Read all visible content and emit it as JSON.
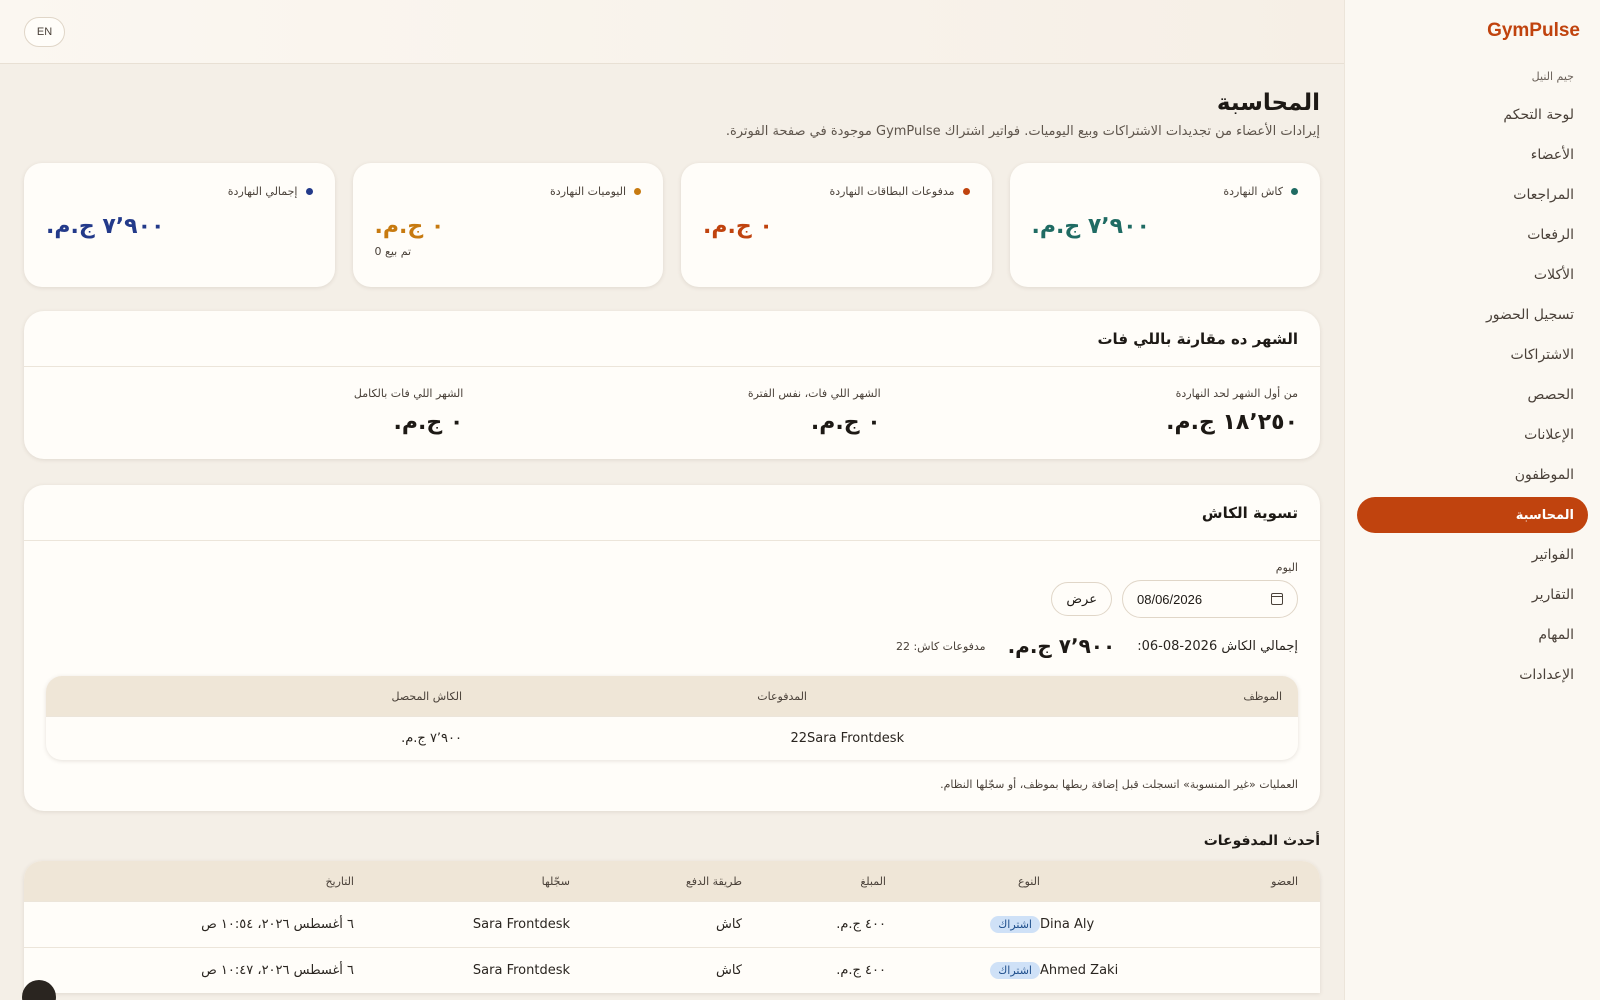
{
  "topbar": {
    "lang_label": "EN"
  },
  "sidebar": {
    "brand": "GymPulse",
    "gym_name": "جيم النيل",
    "items": [
      {
        "label": "لوحة التحكم",
        "key": "dashboard"
      },
      {
        "label": "الأعضاء",
        "key": "members"
      },
      {
        "label": "المراجعات",
        "key": "reviews"
      },
      {
        "label": "الرفعات",
        "key": "lifts"
      },
      {
        "label": "الأكلات",
        "key": "meals"
      },
      {
        "label": "تسجيل الحضور",
        "key": "attendance"
      },
      {
        "label": "الاشتراكات",
        "key": "subscriptions"
      },
      {
        "label": "الحصص",
        "key": "classes"
      },
      {
        "label": "الإعلانات",
        "key": "announcements"
      },
      {
        "label": "الموظفون",
        "key": "staff"
      },
      {
        "label": "المحاسبة",
        "key": "accounting",
        "active": true
      },
      {
        "label": "الفواتير",
        "key": "invoices"
      },
      {
        "label": "التقارير",
        "key": "reports"
      },
      {
        "label": "المهام",
        "key": "tasks"
      },
      {
        "label": "الإعدادات",
        "key": "settings"
      }
    ]
  },
  "header": {
    "title": "المحاسبة",
    "subtitle": "إيرادات الأعضاء من تجديدات الاشتراكات وبيع اليوميات. فواتير اشتراك GymPulse موجودة في صفحة الفوترة."
  },
  "kpis": [
    {
      "label": "كاش النهاردة",
      "value": "٧٬٩٠٠ ج.م.",
      "color": "#1f6b63",
      "note": ""
    },
    {
      "label": "مدفوعات البطاقات النهاردة",
      "value": "٠ ج.م.",
      "color": "#c0430e",
      "note": ""
    },
    {
      "label": "اليوميات النهاردة",
      "value": "٠ ج.م.",
      "color": "#c77a10",
      "note": "تم بيع 0"
    },
    {
      "label": "إجمالي النهاردة",
      "value": "٧٬٩٠٠ ج.م.",
      "color": "#233a8a",
      "note": ""
    }
  ],
  "compare": {
    "title": "الشهر ده مقارنة باللي فات",
    "cols": [
      {
        "label": "من أول الشهر لحد النهاردة",
        "value": "١٨٬٢٥٠ ج.م."
      },
      {
        "label": "الشهر اللي فات، نفس الفترة",
        "value": "٠ ج.م."
      },
      {
        "label": "الشهر اللي فات بالكامل",
        "value": "٠ ج.م."
      }
    ]
  },
  "recon": {
    "title": "تسوية الكاش",
    "day_label": "اليوم",
    "date_value": "08/06/2026",
    "show_label": "عرض",
    "total_label": "إجمالي الكاش 2026-08-06:",
    "total_value": "٧٬٩٠٠ ج.م.",
    "count_label": "مدفوعات كاش: 22",
    "columns": [
      "الموظف",
      "المدفوعات",
      "الكاش المحصل"
    ],
    "rows": [
      {
        "employee": "Sara Frontdesk",
        "payments": "22",
        "cash": "٧٬٩٠٠ ج.م."
      }
    ],
    "note": "العمليات «غير المنسوبة» اتسجلت قبل إضافة ربطها بموظف، أو سجّلها النظام."
  },
  "recent": {
    "title": "أحدث المدفوعات",
    "columns": [
      "العضو",
      "النوع",
      "المبلغ",
      "طريقة الدفع",
      "سجّلها",
      "التاريخ"
    ],
    "rows": [
      {
        "member": "Dina Aly",
        "type": "اشتراك",
        "amount": "٤٠٠ ج.م.",
        "method": "كاش",
        "by": "Sara Frontdesk",
        "date": "٦ أغسطس ٢٠٢٦، ١٠:٥٤ ص"
      },
      {
        "member": "Ahmed Zaki",
        "type": "اشتراك",
        "amount": "٤٠٠ ج.م.",
        "method": "كاش",
        "by": "Sara Frontdesk",
        "date": "٦ أغسطس ٢٠٢٦، ١٠:٤٧ ص"
      }
    ]
  },
  "colors": {
    "accent": "#c0430e",
    "badge_bg": "#cfe1f7"
  }
}
